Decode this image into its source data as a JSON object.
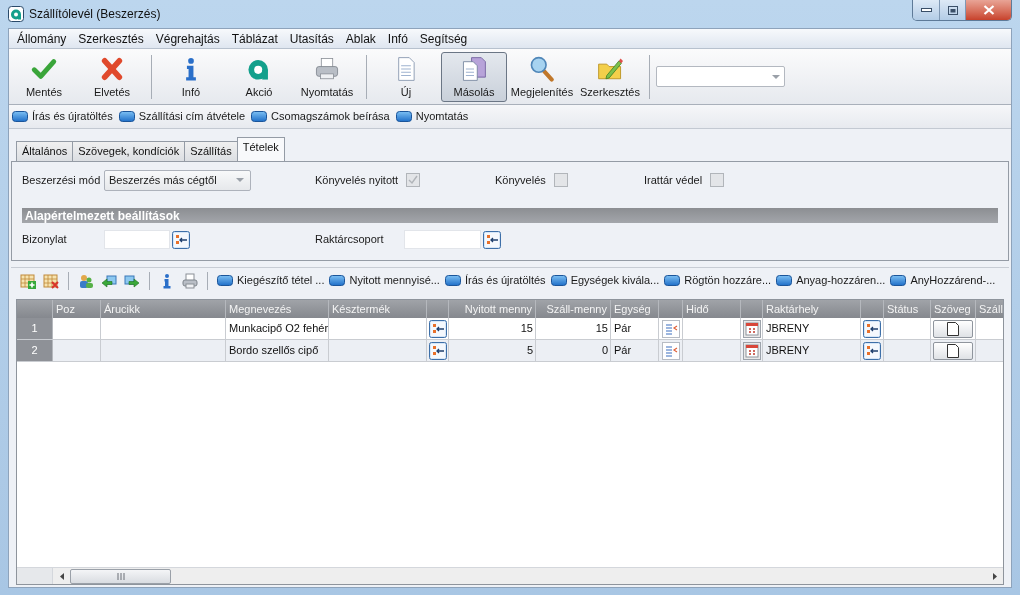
{
  "window": {
    "title": "Szállítólevél (Beszerzés)"
  },
  "menu": [
    "Állomány",
    "Szerkesztés",
    "Végrehajtás",
    "Táblázat",
    "Utasítás",
    "Ablak",
    "Infó",
    "Segítség"
  ],
  "toolbar": {
    "groups": [
      [
        {
          "label": "Mentés",
          "selected": false
        },
        {
          "label": "Elvetés",
          "selected": false
        }
      ],
      [
        {
          "label": "Infó",
          "selected": false
        },
        {
          "label": "Akció",
          "selected": false
        },
        {
          "label": "Nyomtatás",
          "selected": false
        }
      ],
      [
        {
          "label": "Új",
          "selected": false
        },
        {
          "label": "Másolás",
          "selected": true
        },
        {
          "label": "Megjelenítés",
          "selected": false
        },
        {
          "label": "Szerkesztés",
          "selected": false
        }
      ]
    ]
  },
  "action_bar": [
    "Írás és újratöltés",
    "Szállítási cím átvétele",
    "Csomagszámok beírása",
    "Nyomtatás"
  ],
  "tabs": [
    {
      "label": "Általános",
      "selected": false
    },
    {
      "label": "Szövegek, kondíciók",
      "selected": false
    },
    {
      "label": "Szállítás",
      "selected": false
    },
    {
      "label": "Tételek",
      "selected": true
    }
  ],
  "form": {
    "purchase_mode": {
      "label": "Beszerzési mód",
      "value": "Beszerzés más cégtől"
    },
    "checkboxes": [
      {
        "label": "Könyvelés nyitott",
        "checked": true,
        "disabled": true
      },
      {
        "label": "Könyvelés",
        "checked": false,
        "disabled": true
      },
      {
        "label": "Irattár védel",
        "checked": false,
        "disabled": true
      }
    ],
    "section_title": "Alapértelmezett beállítások",
    "lookup_fields": [
      {
        "label": "Bizonylat"
      },
      {
        "label": "Raktárcsoport"
      }
    ]
  },
  "grid_toolbar": {
    "actions": [
      "Kiegészítő tétel ...",
      "Nyitott mennyisé...",
      "Írás és újratöltés",
      "Egységek kivála...",
      "Rögtön hozzáre...",
      "Anyag-hozzáren...",
      "AnyHozzárend-..."
    ]
  },
  "table": {
    "columns": [
      {
        "label": "Poz",
        "kind": "text"
      },
      {
        "label": "Árucikk",
        "kind": "text"
      },
      {
        "label": "Megnevezés",
        "kind": "text"
      },
      {
        "label": "Késztermék",
        "kind": "text"
      },
      {
        "kind": "picker"
      },
      {
        "label": "Nyitott menny",
        "kind": "number"
      },
      {
        "label": "Száll-menny",
        "kind": "number"
      },
      {
        "label": "Egység",
        "kind": "text"
      },
      {
        "kind": "list"
      },
      {
        "label": "Hidő",
        "kind": "text"
      },
      {
        "kind": "calendar"
      },
      {
        "label": "Raktárhely",
        "kind": "text"
      },
      {
        "kind": "picker"
      },
      {
        "label": "Státus",
        "kind": "text"
      },
      {
        "label": "Szöveg",
        "kind": "document"
      },
      {
        "label": "Száll",
        "kind": "text"
      }
    ],
    "rows": [
      {
        "number": "1",
        "name": "Munkacipő O2 fehér",
        "open_quantity": "15",
        "delivery_quantity": "15",
        "unit": "Pár",
        "location": "JBRENY"
      },
      {
        "number": "2",
        "name": "Bordo szellős cipő",
        "open_quantity": "5",
        "delivery_quantity": "0",
        "unit": "Pár",
        "location": "JBRENY"
      }
    ]
  }
}
